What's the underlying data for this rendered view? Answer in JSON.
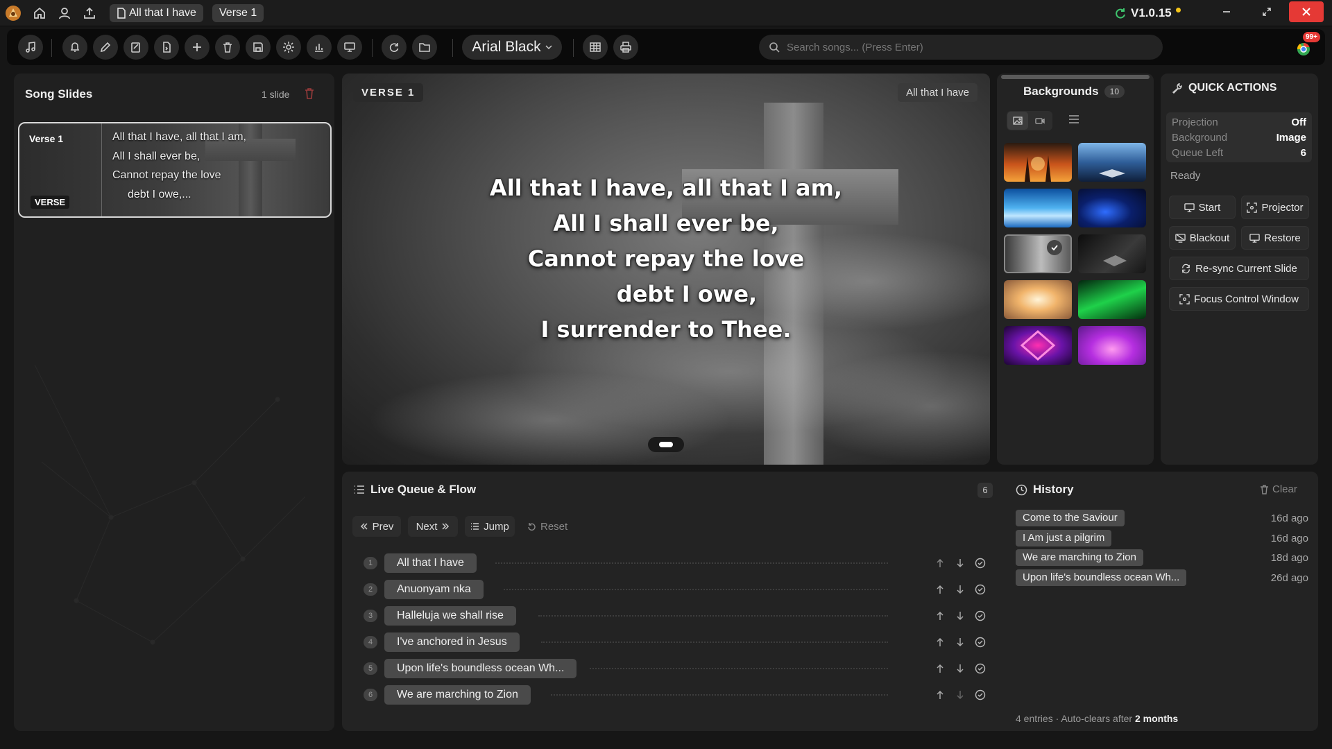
{
  "title_bar": {
    "song_tab": "All that I have",
    "section_tab": "Verse 1",
    "version": "V1.0.15",
    "status_color": "#f5c518"
  },
  "toolbar": {
    "font_name": "Arial Black",
    "search_placeholder": "Search songs... (Press Enter)",
    "notification_count": "99+"
  },
  "slides_panel": {
    "title": "Song Slides",
    "count_label": "1 slide",
    "slide": {
      "name": "Verse 1",
      "badge": "VERSE",
      "lines": [
        "All that I have, all that I am,",
        "All I shall ever be,",
        "Cannot repay the love",
        "debt I owe,..."
      ]
    }
  },
  "preview": {
    "section_label": "VERSE 1",
    "song_label": "All that I have",
    "lyrics": [
      "All that I have, all that I am,",
      "All I shall ever be,",
      "Cannot repay the love",
      "debt I owe,",
      "I surrender to Thee."
    ]
  },
  "backgrounds": {
    "title": "Backgrounds",
    "count": "10",
    "selected_index": 4
  },
  "quick_actions": {
    "title": "QUICK ACTIONS",
    "status_rows": [
      {
        "label": "Projection",
        "value": "Off"
      },
      {
        "label": "Background",
        "value": "Image"
      },
      {
        "label": "Queue Left",
        "value": "6"
      }
    ],
    "status_text": "Ready",
    "start": "Start",
    "projector": "Projector",
    "blackout": "Blackout",
    "restore": "Restore",
    "resync": "Re-sync Current Slide",
    "focus": "Focus Control Window"
  },
  "queue": {
    "title": "Live Queue & Flow",
    "count": "6",
    "prev": "Prev",
    "next": "Next",
    "jump": "Jump",
    "reset": "Reset",
    "items": [
      {
        "num": "1",
        "title": "All that I have"
      },
      {
        "num": "2",
        "title": "Anuonyam nka"
      },
      {
        "num": "3",
        "title": "Halleluja we shall rise"
      },
      {
        "num": "4",
        "title": "I've anchored in Jesus"
      },
      {
        "num": "5",
        "title": "Upon life's boundless ocean Wh..."
      },
      {
        "num": "6",
        "title": "We are marching to Zion"
      }
    ]
  },
  "history": {
    "title": "History",
    "clear": "Clear",
    "entries": [
      {
        "title": "Come to the Saviour",
        "time": "16d ago"
      },
      {
        "title": "I Am just a pilgrim",
        "time": "16d ago"
      },
      {
        "title": "We are marching to Zion",
        "time": "18d ago"
      },
      {
        "title": "Upon life's boundless ocean Wh...",
        "time": "26d ago"
      }
    ],
    "footer_prefix": "4 entries · Auto-clears after",
    "footer_bold": "2 months"
  }
}
